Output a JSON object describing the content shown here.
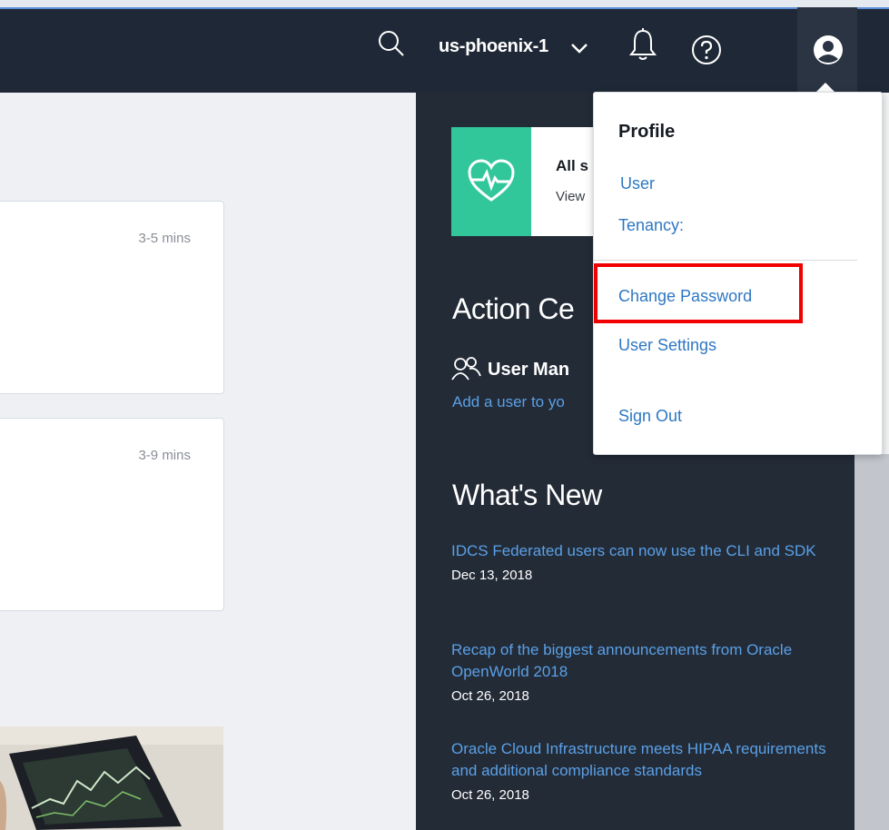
{
  "header": {
    "region": "us-phoenix-1",
    "icons": [
      "search-icon",
      "chevron-down-icon",
      "bell-icon",
      "help-icon",
      "user-avatar-icon"
    ]
  },
  "cards": [
    {
      "duration": "3-5 mins"
    },
    {
      "duration": "3-9 mins"
    }
  ],
  "status": {
    "title": "All s",
    "subtitle": "View",
    "icon": "heart-pulse-icon",
    "color": "#31c79a"
  },
  "action_center": {
    "title": "Action Ce",
    "user_management": {
      "icon": "users-icon",
      "title": "User Man",
      "link": "Add a user to yo"
    }
  },
  "whats_new": {
    "title": "What's New",
    "items": [
      {
        "title": "IDCS Federated users can now use the CLI and SDK",
        "date": "Dec 13, 2018"
      },
      {
        "title": "Recap of the biggest announcements from Oracle OpenWorld 2018",
        "date": "Oct 26, 2018"
      },
      {
        "title": "Oracle Cloud Infrastructure meets HIPAA requirements and additional compliance standards",
        "date": "Oct 26, 2018"
      }
    ]
  },
  "profile_menu": {
    "title": "Profile",
    "user": "User",
    "tenancy": "Tenancy:",
    "change_password": "Change Password",
    "user_settings": "User Settings",
    "sign_out": "Sign Out",
    "highlight_color": "#f00000"
  },
  "colors": {
    "topbar": "#1f2836",
    "panel": "#232b37",
    "link": "#5aa0e6",
    "accent_green": "#31c79a"
  }
}
